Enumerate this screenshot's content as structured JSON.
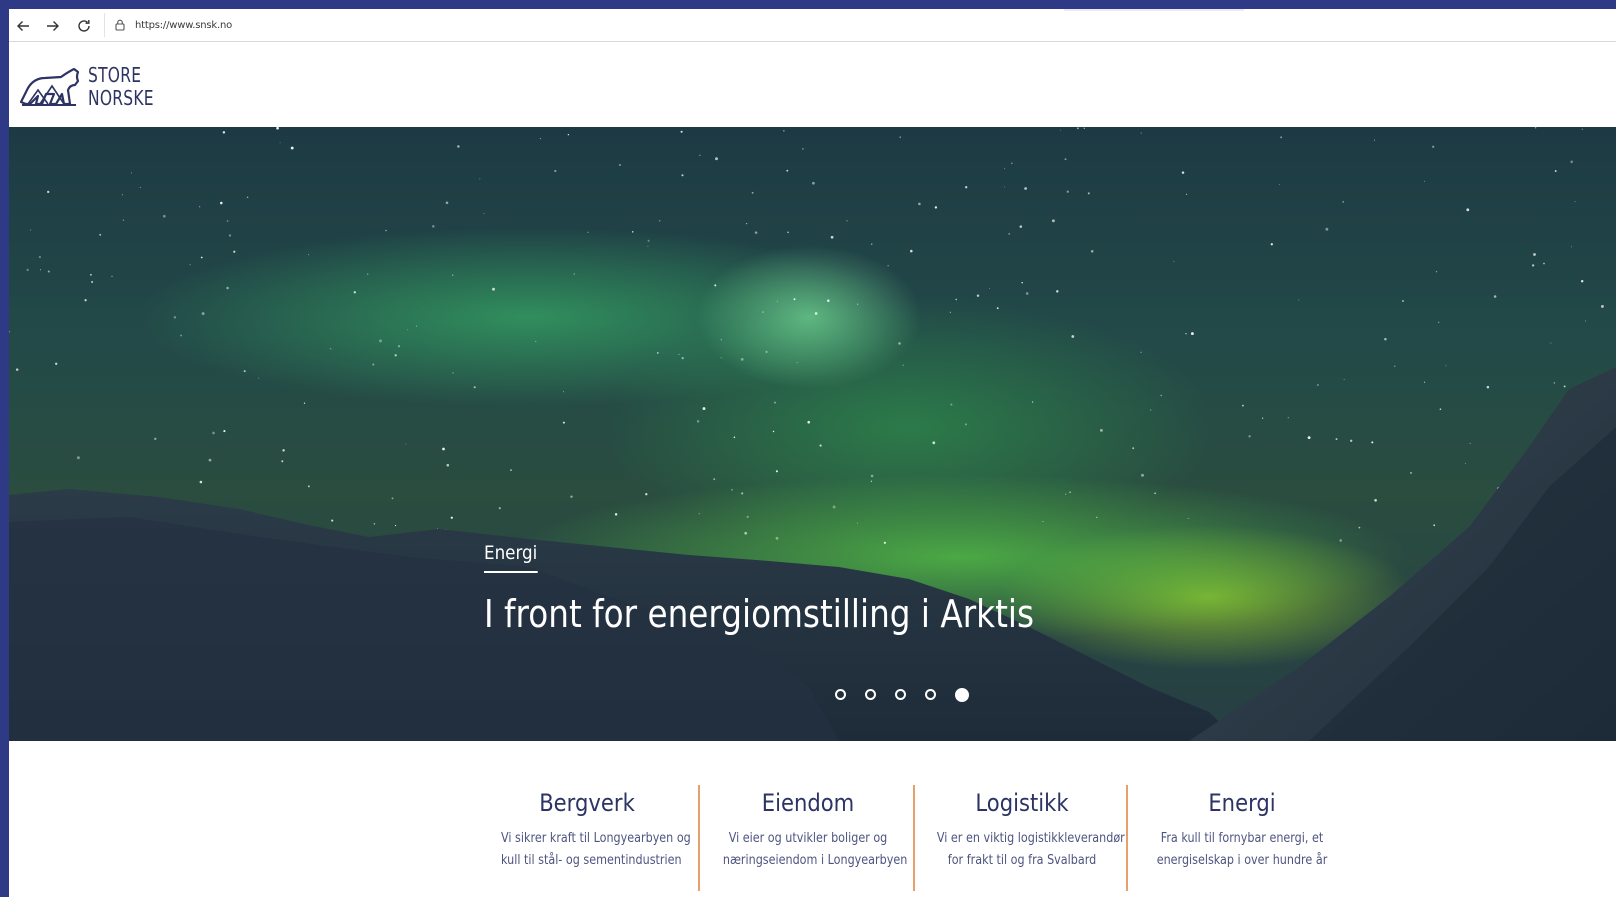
{
  "browser": {
    "url": "https://www.snsk.no",
    "back_icon": "arrow-left-icon",
    "forward_icon": "arrow-right-icon",
    "reload_icon": "reload-icon",
    "lock_icon": "lock-icon"
  },
  "header": {
    "logo_line1": "STORE",
    "logo_line2": "NORSKE",
    "brand_color": "#2d3464"
  },
  "hero": {
    "category": "Energi",
    "headline": "I front for energiomstilling i Arktis",
    "slides_total": 5,
    "active_slide": 5
  },
  "features": [
    {
      "title": "Bergverk",
      "desc_line1": "Vi sikrer kraft til Longyearbyen og",
      "desc_line2": "kull til stål- og sementindustrien"
    },
    {
      "title": "Eiendom",
      "desc_line1": "Vi eier og utvikler boliger og",
      "desc_line2": "næringseiendom i Longyearbyen"
    },
    {
      "title": "Logistikk",
      "desc_line1": "Vi er en viktig logistikkleverandør",
      "desc_line2": "for frakt til og fra Svalbard"
    },
    {
      "title": "Energi",
      "desc_line1": "Fra kull til fornybar energi, et",
      "desc_line2": "energiselskap i over hundre år"
    }
  ],
  "colors": {
    "accent_separator": "#e8a06b",
    "frame": "#2f3a86"
  }
}
